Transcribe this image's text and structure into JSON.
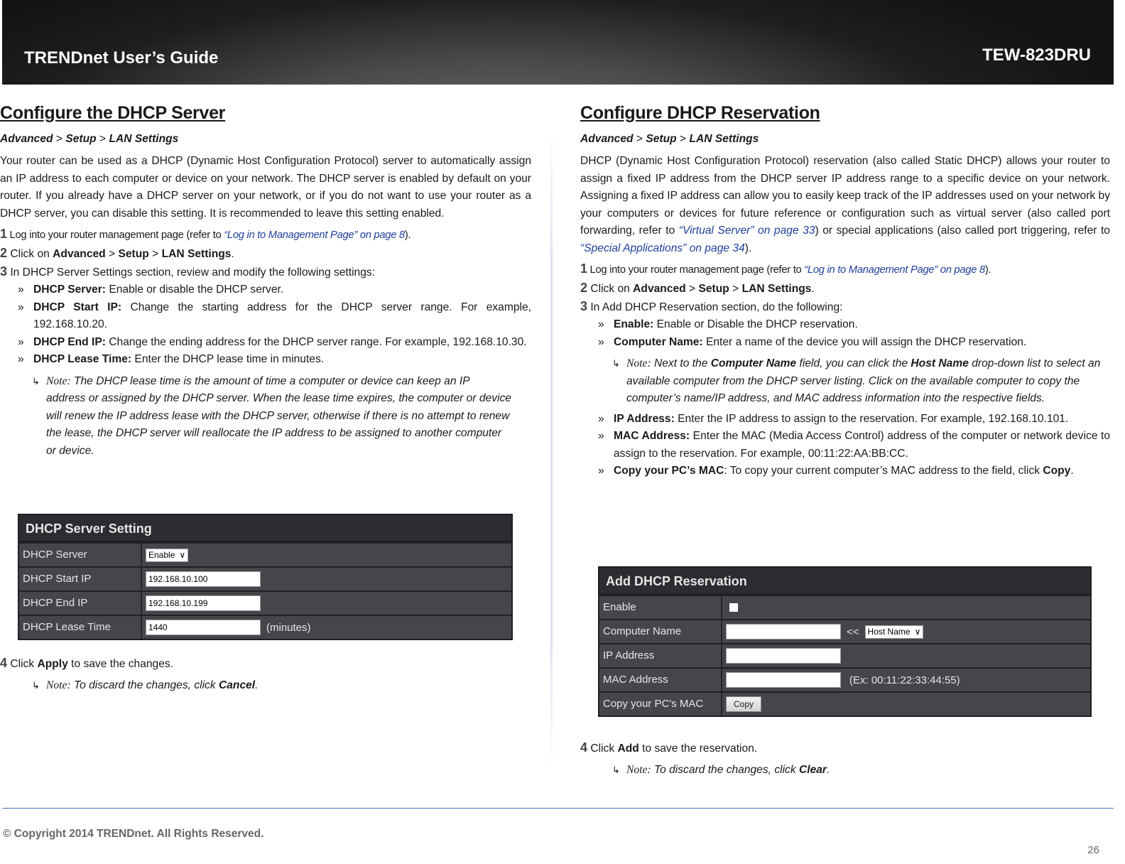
{
  "header": {
    "brand": "TRENDnet User’s Guide",
    "model": "TEW-823DRU"
  },
  "left": {
    "title": "Configure the DHCP Server",
    "crumb": [
      "Advanced",
      ">",
      "Setup",
      ">",
      "LAN Settings"
    ],
    "intro": "Your router can be used as a DHCP (Dynamic Host Configuration Protocol) server to automatically assign an IP address to each computer or device on your network. The DHCP server is enabled by default on your router. If you already have a DHCP server on your network, or if you do not want to use your router as a DHCP server, you can disable this setting. It is recommended to leave this setting enabled.",
    "step1": {
      "num": "1",
      "text": " Log into your router management page (refer to ",
      "link": "“Log in to Management Page” on page 8",
      "end": ")."
    },
    "step2": {
      "num": "2",
      "text": " Click on ",
      "a": "Advanced",
      "s1": " > ",
      "b": "Setup",
      "s2": " > ",
      "c": "LAN Settings",
      "end": "."
    },
    "step3": {
      "num": "3",
      "text": " In DHCP Server Settings section, review and modify the following settings:"
    },
    "bullets": [
      {
        "label": "DHCP Server:",
        "text": " Enable or disable the DHCP server."
      },
      {
        "label": "DHCP Start IP:",
        "text": " Change the starting address for the DHCP server range. For example, 192.168.10.20."
      },
      {
        "label": "DHCP End IP:",
        "text": " Change the ending address for the DHCP server range. For example, 192.168.10.30."
      },
      {
        "label": "DHCP Lease Time:",
        "text": " Enter the DHCP lease time in minutes."
      }
    ],
    "note": {
      "label": "Note:",
      "text": " The DHCP lease time is the amount of time a computer or device can keep an IP address or assigned by the DHCP server. When the lease time expires, the computer or device will renew the IP address lease with the DHCP server, otherwise if there is no attempt to renew the lease, the DHCP server will reallocate the IP address to be assigned to another computer or device."
    },
    "table": {
      "title": "DHCP Server Setting",
      "rows": [
        {
          "label": "DHCP Server",
          "value": "Enable"
        },
        {
          "label": "DHCP Start IP",
          "value": "192.168.10.100"
        },
        {
          "label": "DHCP End IP",
          "value": "192.168.10.199"
        },
        {
          "label": "DHCP Lease Time",
          "value": "1440",
          "suffix": "(minutes)"
        }
      ]
    },
    "step4": {
      "num": "4",
      "text": " Click ",
      "a": "Apply",
      "end": " to save the changes."
    },
    "note2": {
      "label": "Note:",
      "text": " To discard the changes, click ",
      "b": "Cancel",
      "end": "."
    }
  },
  "right": {
    "title": "Configure DHCP Reservation",
    "crumb": [
      "Advanced",
      ">",
      "Setup",
      ">",
      "LAN Settings"
    ],
    "intro1": "DHCP (Dynamic Host Configuration Protocol) reservation (also called Static DHCP) allows your router to assign a fixed IP address from the DHCP server IP address range to a specific device on your network. Assigning a fixed IP address can allow you to easily keep track of the IP addresses used on your network by your computers or devices for future reference or configuration such as virtual server (also called port forwarding, refer to ",
    "link1": "“Virtual Server” on page 33",
    "intro2": ") or special applications (also called port triggering, refer to ",
    "link2": "“Special Applications” on page 34",
    "intro3": ").",
    "step1": {
      "num": "1",
      "text": " Log into your router management page (refer to ",
      "link": "“Log in to Management Page” on page 8",
      "end": ")."
    },
    "step2": {
      "num": "2",
      "text": " Click on ",
      "a": "Advanced",
      "s1": " > ",
      "b": "Setup",
      "s2": " > ",
      "c": "LAN Settings",
      "end": "."
    },
    "step3": {
      "num": "3",
      "text": " In Add DHCP Reservation section, do the following:"
    },
    "bullets": [
      {
        "label": "Enable:",
        "text": " Enable or Disable the DHCP reservation."
      },
      {
        "label": "Computer Name:",
        "text": " Enter a name of the device you will assign the DHCP reservation."
      }
    ],
    "note": {
      "label": "Note:",
      "t1": " Next to the ",
      "b1": "Computer Name",
      "t2": " field, you can click the ",
      "b2": "Host Name",
      "t3": " drop-down list to select an available computer from the DHCP server listing. Click on the available computer to copy the computer’s name/IP address, and MAC address information into the respective fields."
    },
    "bullets2": [
      {
        "label": "IP Address:",
        "text": " Enter the IP address to assign to the reservation. For example, 192.168.10.101."
      },
      {
        "label": "MAC Address:",
        "text": " Enter the MAC (Media Access Control) address of the computer or network device to assign to the reservation. For example, 00:11:22:AA:BB:CC."
      },
      {
        "label": "Copy your PC’s MAC",
        "text": ": To copy your current computer’s MAC address to the field, click ",
        "b": "Copy",
        "end": "."
      }
    ],
    "table": {
      "title": "Add DHCP Reservation",
      "rows": [
        {
          "label": "Enable"
        },
        {
          "label": "Computer Name",
          "arrows": "<<",
          "select": "Host Name"
        },
        {
          "label": "IP Address"
        },
        {
          "label": "MAC Address",
          "hint": "(Ex: 00:11:22:33:44:55)"
        },
        {
          "label": "Copy your PC's MAC",
          "button": "Copy"
        }
      ]
    },
    "step4": {
      "num": "4",
      "text": " Click ",
      "a": "Add",
      "end": " to save the reservation."
    },
    "note2": {
      "label": "Note:",
      "text": " To discard the changes, click ",
      "b": "Clear",
      "end": "."
    }
  },
  "footer": {
    "copyright": "© Copyright 2014 TRENDnet. All Rights Reserved.",
    "page": "26"
  },
  "bullet_marker": "»"
}
